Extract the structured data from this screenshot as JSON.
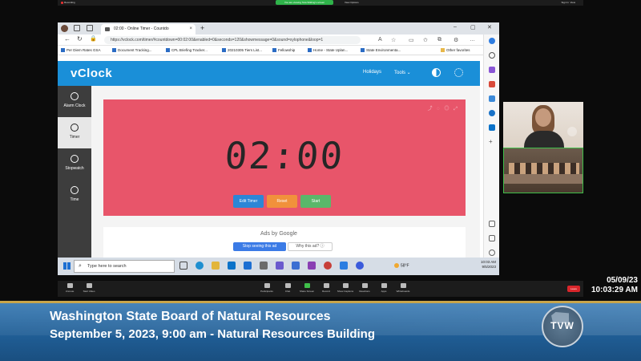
{
  "zoom": {
    "recording_label": "Recording",
    "share_banner": "You are viewing Tara Wilding's screen",
    "view_options": "View Options",
    "signin": "Sign In",
    "view": "View",
    "bottom_toolbar": [
      "Unmute",
      "Start Video",
      "Participants",
      "Chat",
      "Share Screen",
      "Record",
      "Show Captions",
      "Reactions",
      "Apps",
      "Whiteboards"
    ],
    "leave_label": "Leave"
  },
  "browser": {
    "tab_title": "02:00 - Online Timer - Countdo",
    "url": "https://vclock.com/timer/#countdown=00:02:00&enabled=0&seconds=120&showmessage=0&sound=xylophone&loop=1",
    "favorites": [
      "Per Diem Rates  GSA",
      "Document Tracking...",
      "CPL Briefing Tracker...",
      "20210305 Tiers List...",
      "Fellowship",
      "Home - State Uplan...",
      "State Environmenta..."
    ],
    "other_favorites": "Other favorites"
  },
  "app": {
    "logo": "vClock",
    "nav": {
      "holidays": "Holidays",
      "tools": "Tools"
    },
    "sidebar": [
      {
        "label": "Alarm Clock",
        "icon": "alarm-clock-icon",
        "active": false
      },
      {
        "label": "Timer",
        "icon": "timer-icon",
        "active": true
      },
      {
        "label": "Stopwatch",
        "icon": "stopwatch-icon",
        "active": false
      },
      {
        "label": "Time",
        "icon": "clock-icon",
        "active": false
      }
    ],
    "timer": {
      "display": "02:00",
      "edit": "Edit Timer",
      "reset": "Reset",
      "start": "Start"
    },
    "ad": {
      "ads_by": "Ads by Google",
      "stop": "Stop seeing this ad",
      "why": "Why this ad? ⓘ"
    }
  },
  "taskbar": {
    "search_placeholder": "Type here to search",
    "weather": "58°F",
    "time": "10:03 AM",
    "date": "9/5/2023"
  },
  "stamp": {
    "date": "05/09/23",
    "time": "10:03:29 AM"
  },
  "banner": {
    "title": "Washington State Board of Natural Resources",
    "subtitle": "September 5, 2023, 9:00 am - Natural Resources Building",
    "logo": "TVW"
  },
  "colors": {
    "timer_bg": "#e8556a",
    "header_blue": "#1a8fd8",
    "banner_blue": "#1f5c93"
  }
}
